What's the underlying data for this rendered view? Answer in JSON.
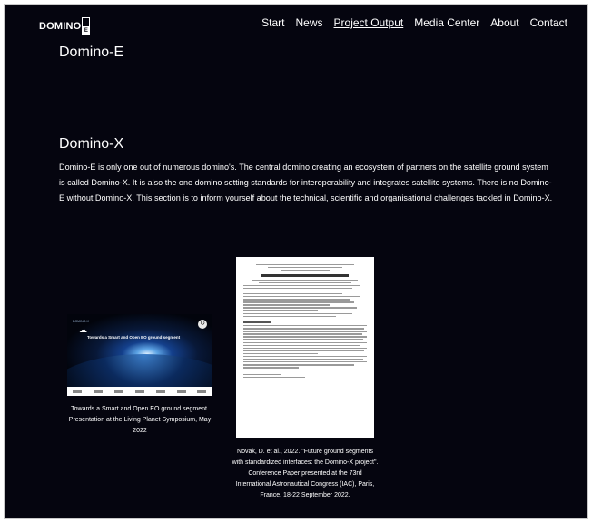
{
  "header": {
    "logo_text": "DOMINO",
    "logo_mark_letter": "E",
    "nav": [
      {
        "label": "Start",
        "active": false
      },
      {
        "label": "News",
        "active": false
      },
      {
        "label": "Project Output",
        "active": true
      },
      {
        "label": "Media Center",
        "active": false
      },
      {
        "label": "About",
        "active": false
      },
      {
        "label": "Contact",
        "active": false
      }
    ]
  },
  "sections": {
    "domino_e_title": "Domino-E",
    "domino_x_title": "Domino-X",
    "domino_x_text": "Domino-E is only one out of numerous domino's. The central domino creating an ecosystem of partners on the satellite ground system is called Domino-X. It is also the one domino setting standards for interoperability and integrates satellite systems. There is no Domino-E without Domino-X. This section is to inform yourself about the technical, scientific and organisational challenges tackled in Domino-X."
  },
  "outputs": [
    {
      "thumb_title": "Towards a Smart and Open EO ground segment",
      "thumb_brand": "DOMINO-X",
      "caption": "Towards a Smart and Open EO ground segment. Presentation at the Living Planet Symposium, May 2022"
    },
    {
      "caption": "Novak, D. et al., 2022. \"Future ground segments with standardized interfaces: the Domino-X project\". Conference Paper presented at the 73rd International Astronautical Congress (IAC), Paris, France. 18-22 September 2022."
    }
  ],
  "colors": {
    "page_background": "#05050f",
    "text": "#ffffff"
  }
}
